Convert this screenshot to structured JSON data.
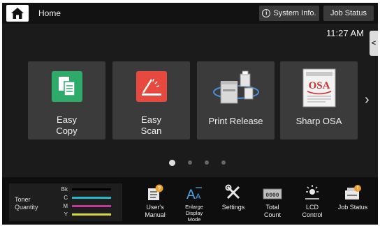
{
  "topbar": {
    "home_label": "Home",
    "system_info_label": "System Info.",
    "job_status_label": "Job Status"
  },
  "clock": "11:27 AM",
  "side_tab_glyph": "<",
  "tiles": [
    {
      "label_line1": "Easy",
      "label_line2": "Copy",
      "icon": "copy-icon",
      "color": "#2eab6b"
    },
    {
      "label_line1": "Easy",
      "label_line2": "Scan",
      "icon": "scan-icon",
      "color": "#e8493f"
    },
    {
      "label_line1": "Print Release",
      "label_line2": "",
      "icon": "printer-icon"
    },
    {
      "label_line1": "Sharp OSA",
      "label_line2": "",
      "icon": "osa-document-icon"
    }
  ],
  "next_arrow": "›",
  "pagination": {
    "pages": 4,
    "active": 0
  },
  "toner": {
    "title_line1": "Toner",
    "title_line2": "Quantity",
    "rows": [
      {
        "key": "Bk",
        "color": "#000000"
      },
      {
        "key": "C",
        "color": "#27b6c9"
      },
      {
        "key": "M",
        "color": "#c03a9a"
      },
      {
        "key": "Y",
        "color": "#d9d93a"
      }
    ]
  },
  "bottom_items": [
    {
      "line1": "User's",
      "line2": "Manual",
      "line3": "",
      "icon": "manual-icon"
    },
    {
      "line1": "Enlarge",
      "line2": "Display",
      "line3": "Mode",
      "icon": "enlarge-text-icon"
    },
    {
      "line1": "Settings",
      "line2": "",
      "line3": "",
      "icon": "settings-icon"
    },
    {
      "line1": "Total",
      "line2": "Count",
      "line3": "",
      "icon": "counter-icon",
      "counter_text": "0000"
    },
    {
      "line1": "LCD",
      "line2": "Control",
      "line3": "",
      "icon": "brightness-icon"
    },
    {
      "line1": "Job Status",
      "line2": "",
      "line3": "",
      "icon": "job-status-icon"
    }
  ]
}
